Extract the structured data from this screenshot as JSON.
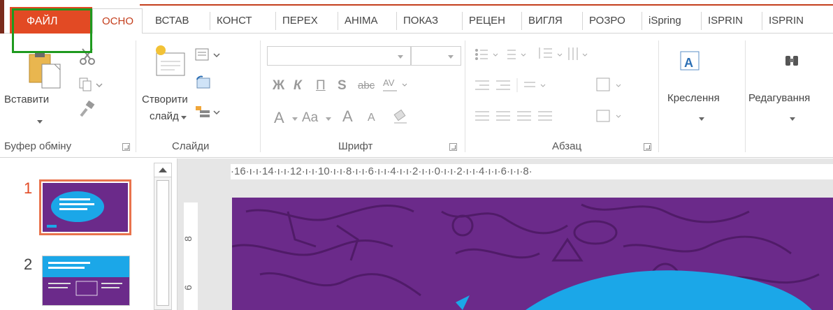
{
  "tabs": [
    {
      "label": "ФАЙЛ"
    },
    {
      "label": "ОСНО"
    },
    {
      "label": "ВСТАВ"
    },
    {
      "label": "КОНСТ"
    },
    {
      "label": "ПЕРЕХ"
    },
    {
      "label": "АНІМА"
    },
    {
      "label": "ПОКАЗ"
    },
    {
      "label": "РЕЦЕН"
    },
    {
      "label": "ВИГЛЯ"
    },
    {
      "label": "РОЗРО"
    },
    {
      "label": "iSpring"
    },
    {
      "label": "ISPRIN"
    },
    {
      "label": "ISPRIN"
    }
  ],
  "ribbon": {
    "clipboard": {
      "paste_label": "Вставити",
      "group_label": "Буфер обміну"
    },
    "slides": {
      "new_slide_label_1": "Створити",
      "new_slide_label_2": "слайд",
      "group_label": "Слайди"
    },
    "font": {
      "group_label": "Шрифт",
      "bold": "Ж",
      "italic": "К",
      "underline": "П",
      "shadow": "S",
      "strike": "abc",
      "grow": "A",
      "shrink": "A",
      "color": "A",
      "case": "Aa"
    },
    "paragraph": {
      "group_label": "Абзац"
    },
    "drawing": {
      "label": "Креслення"
    },
    "editing": {
      "label": "Редагування"
    }
  },
  "ruler": {
    "text": "·16·ı·ı·14·ı·ı·12·ı·ı·10·ı·ı·8·ı·ı·6·ı·ı·4·ı·ı·2·ı·ı·0·ı·ı·2·ı·ı·4·ı·ı·6·ı·ı·8·"
  },
  "vruler": {
    "mark_1": "8",
    "mark_2": "6"
  },
  "slides": [
    {
      "number": "1"
    },
    {
      "number": "2"
    }
  ],
  "colors": {
    "file_tab": "#e24a24",
    "accent": "#c43e1c",
    "slide_bg": "#6b2a8a",
    "highlight_box": "#1e9a1e",
    "slide_blue": "#1ba7e8"
  }
}
